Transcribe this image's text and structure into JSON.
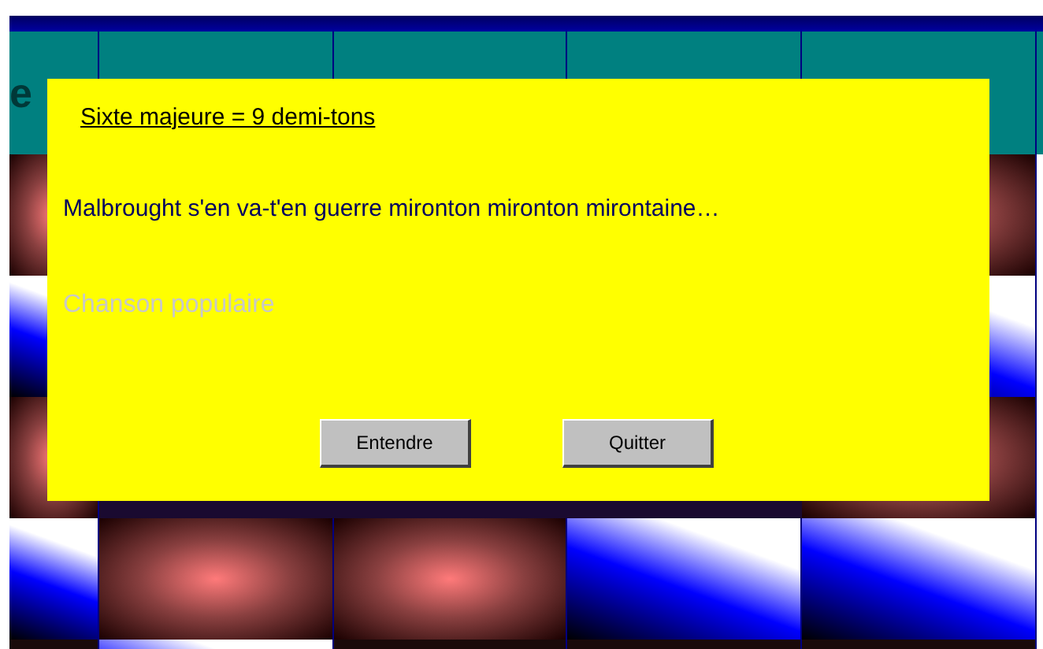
{
  "header": [
    {
      "label": "e"
    }
  ],
  "rows": [
    {
      "tiles": [
        {
          "kind": "pyramid"
        },
        {
          "kind": "pyramid"
        }
      ]
    },
    {
      "tiles": [
        {
          "kind": "sweep"
        },
        {
          "kind": "sweep"
        }
      ]
    },
    {
      "tiles": [
        {
          "kind": "pyramid"
        },
        {
          "kind": "pyramid"
        }
      ]
    },
    {
      "tiles": [
        {
          "kind": "sweep"
        },
        {
          "kind": "pyramid"
        },
        {
          "kind": "pyramid"
        },
        {
          "kind": "sweep"
        },
        {
          "kind": "sweep"
        }
      ]
    },
    {
      "tiles": [
        {
          "kind": "plain"
        },
        {
          "kind": "sweep"
        },
        {
          "kind": "plain"
        },
        {
          "kind": "plain"
        },
        {
          "kind": "plain"
        }
      ]
    }
  ],
  "dialog": {
    "title": "Sixte majeure = 9 demi-tons",
    "lyrics": "Malbrought s'en va-t'en guerre mironton mironton mirontaine…",
    "source": "Chanson populaire",
    "buttons": [
      "Entendre",
      "Quitter"
    ]
  }
}
